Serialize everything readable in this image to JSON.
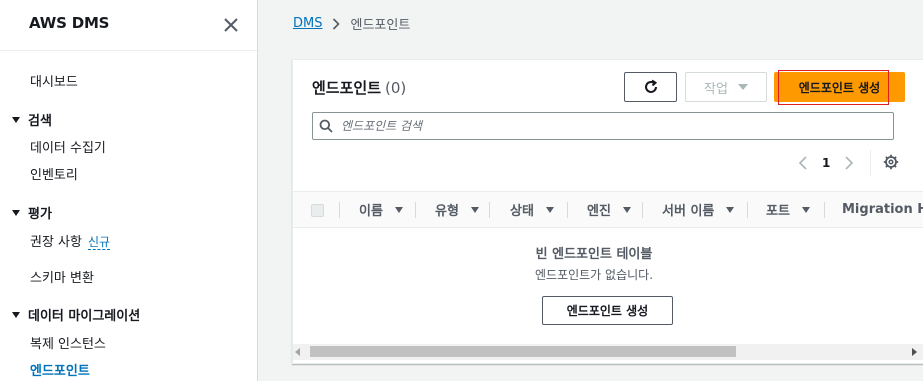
{
  "sidebar": {
    "title": "AWS DMS",
    "dashboard": "대시보드",
    "sections": [
      {
        "label": "검색",
        "items": [
          "데이터 수집기"
        ]
      },
      {
        "label": "인벤토리"
      },
      {
        "label": "평가",
        "items": [
          "권장 사항"
        ],
        "badge": "신규"
      },
      {
        "label": "스키마 변환"
      },
      {
        "label": "데이터 마이그레이션",
        "items": [
          "복제 인스턴스",
          "엔드포인트"
        ]
      }
    ],
    "discover_label": "검색",
    "collectors": "데이터 수집기",
    "inventory": "인벤토리",
    "assess_label": "평가",
    "recommendations": "권장 사항",
    "new_badge": "신규",
    "schema_conversion": "스키마 변환",
    "migration_label": "데이터 마이그레이션",
    "replication_instances": "복제 인스턴스",
    "endpoints": "엔드포인트"
  },
  "breadcrumb": {
    "root": "DMS",
    "current": "엔드포인트"
  },
  "panel": {
    "title": "엔드포인트",
    "count": "(0)",
    "action_label": "작업",
    "create_label": "엔드포인트 생성",
    "search_placeholder": "엔드포인트 검색",
    "page_number": "1",
    "columns": {
      "name": "이름",
      "type": "유형",
      "status": "상태",
      "engine": "엔진",
      "server": "서버 이름",
      "port": "포트",
      "migration_hub": "Migration Hul"
    },
    "empty_title": "빈 엔드포인트 테이블",
    "empty_desc": "엔드포인트가 없습니다.",
    "empty_create_label": "엔드포인트 생성"
  },
  "colors": {
    "accent": "#ff9900",
    "link": "#0073bb",
    "highlight": "#e02020"
  }
}
